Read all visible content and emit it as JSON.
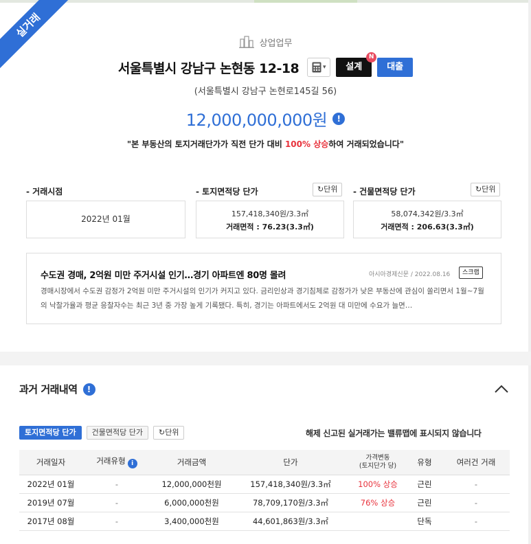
{
  "ribbon": "실거래",
  "category": "상업업무",
  "address": "서울특별시 강남구 논현동 12-18",
  "road_address": "(서울특별시 강남구 논현로145길 56)",
  "buttons": {
    "calc_icon": "calculator-icon",
    "design": "설계",
    "design_badge": "N",
    "loan": "대출"
  },
  "price": "12,000,000,000원",
  "quote": {
    "before": "\"본 부동산의 토지거래단가가 직전 단가 대비 ",
    "highlight": "100% 상승",
    "after": "하여 거래되었습니다\""
  },
  "summary": {
    "trade_date_label": "- 거래시점",
    "trade_date": "2022년 01월",
    "land_label": "- 토지면적당 단가",
    "land_unit_btn": "단위",
    "land_price": "157,418,340원/3.3㎡",
    "land_area": "거래면적 : 76.23(3.3㎡)",
    "bldg_label": "- 건물면적당 단가",
    "bldg_unit_btn": "단위",
    "bldg_price": "58,074,342원/3.3㎡",
    "bldg_area": "거래면적 : 206.63(3.3㎡)"
  },
  "news": {
    "title": "수도권 경매, 2억원 미만 주거시설 인기…경기 아파트엔 80명 몰려",
    "source": "아시아경제신문",
    "date": "2022.08.16",
    "scrap": "스크랩",
    "body": "경매시장에서 수도권 감정가 2억원 미만 주거시설의 인기가 커지고 있다. 금리인상과 경기침체로 감정가가 낮은 부동산에 관심이 쏠리면서 1월~7월의 낙찰가율과 평균 응찰자수는 최근 3년 중 가장 높게 기록됐다. 특히, 경기는 아파트에서도 2억원 대 미만에 수요가 늘면…"
  },
  "history": {
    "title": "과거 거래내역",
    "tabs": [
      "토지면적당 단가",
      "건물면적당 단가"
    ],
    "unit_btn": "단위",
    "notice": "해제 신고된 실거래가는 밸류맵에 표시되지 않습니다",
    "headers": [
      "거래일자",
      "거래유형",
      "거래금액",
      "단가",
      "가격변동",
      "(토지단가 당)",
      "유형",
      "여러건 거래"
    ],
    "rows": [
      {
        "date": "2022년 01월",
        "type": "-",
        "amount": "12,000,000천원",
        "unit_price": "157,418,340원/3.3㎡",
        "change": "100% 상승",
        "kind": "근린",
        "multi": "-"
      },
      {
        "date": "2019년 07월",
        "type": "-",
        "amount": "6,000,000천원",
        "unit_price": "78,709,170원/3.3㎡",
        "change": "76% 상승",
        "kind": "근린",
        "multi": "-"
      },
      {
        "date": "2017년 08월",
        "type": "-",
        "amount": "3,400,000천원",
        "unit_price": "44,601,863원/3.3㎡",
        "change": "",
        "kind": "단독",
        "multi": "-"
      }
    ]
  },
  "colors": {
    "accent": "#2f6fd6",
    "up": "#e8323c",
    "badge": "#e84a5f"
  }
}
